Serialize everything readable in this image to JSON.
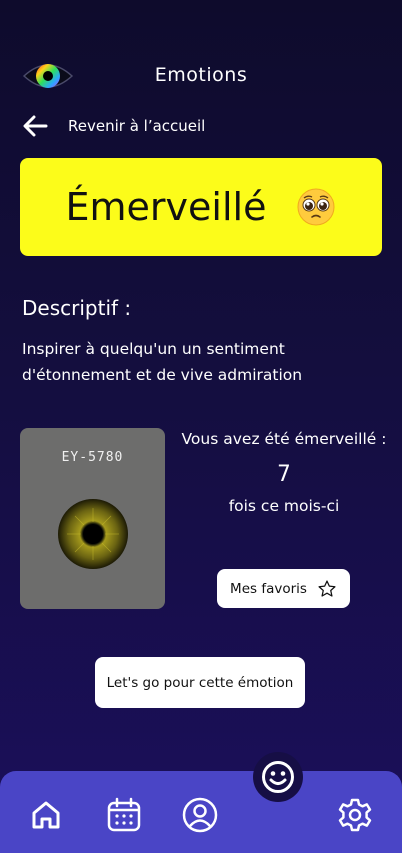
{
  "header": {
    "title": "Emotions"
  },
  "nav_back": {
    "label": "Revenir à l’accueil"
  },
  "emotion": {
    "name": "Émerveillé",
    "emoji_icon": "pleading-face-emoji",
    "card_color": "#fcfc1a"
  },
  "description": {
    "title": "Descriptif :",
    "text": "Inspirer à quelqu'un un sentiment d'étonnement et de vive admiration"
  },
  "eye_card": {
    "code": "EY-5780"
  },
  "stats": {
    "line1": "Vous avez été émerveillé :",
    "count": "7",
    "line2": "fois ce mois-ci"
  },
  "buttons": {
    "favorites": "Mes favoris",
    "go": "Let's go pour cette émotion"
  },
  "bottom_nav": {
    "items": [
      "home-icon",
      "calendar-icon",
      "profile-icon",
      "settings-icon"
    ],
    "fab_icon": "smiley-icon",
    "color": "#4a45c6"
  }
}
